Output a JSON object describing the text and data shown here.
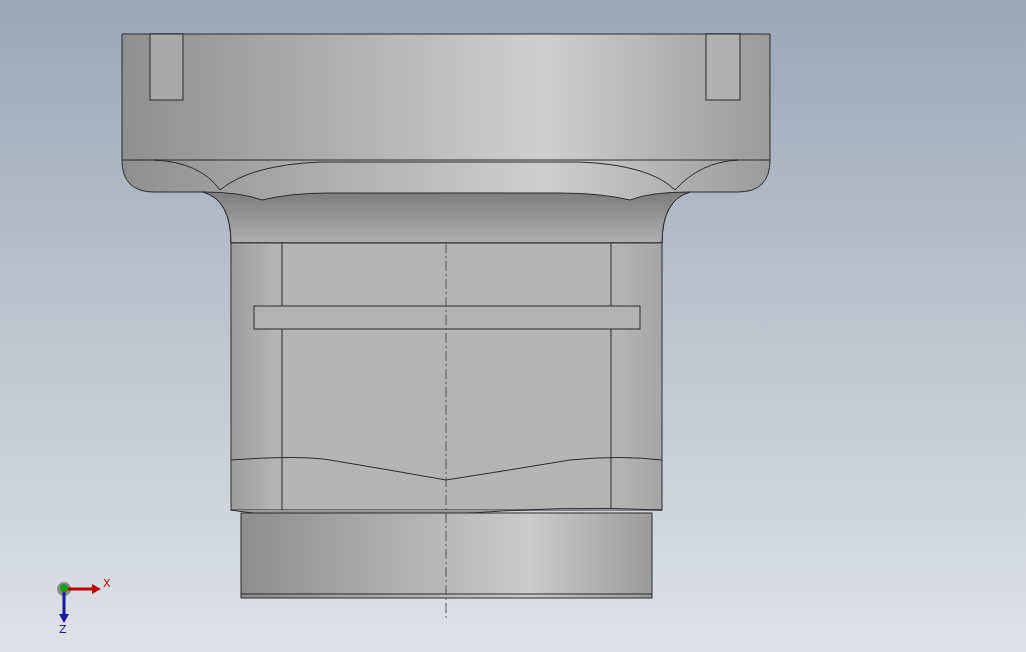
{
  "viewport": {
    "triad": {
      "x_label": "X",
      "z_label": "Z"
    }
  }
}
